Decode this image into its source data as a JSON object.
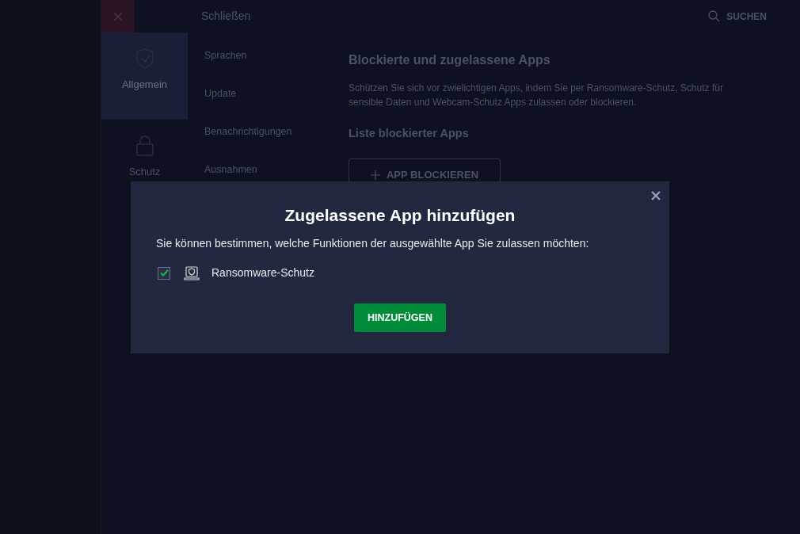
{
  "header": {
    "close_label": "Schließen",
    "search_label": "SUCHEN"
  },
  "categories": [
    {
      "label": "Allgemein",
      "kind": "shield",
      "selected": true
    },
    {
      "label": "Schutz",
      "kind": "lock",
      "selected": false
    }
  ],
  "menu": [
    {
      "label": "Sprachen"
    },
    {
      "label": "Update"
    },
    {
      "label": "Benachrichtigungen"
    },
    {
      "label": "Ausnahmen"
    }
  ],
  "content": {
    "title": "Blockierte und zugelassene Apps",
    "description": "Schützen Sie sich vor zwielichtigen Apps, indem Sie per Ransomware-Schutz, Schutz für sensible Daten und Webcam-Schutz Apps zulassen oder blockieren.",
    "list_title": "Liste blockierter Apps",
    "block_button": "APP BLOCKIEREN"
  },
  "dialog": {
    "title": "Zugelassene App hinzufügen",
    "text": "Sie können bestimmen, welche Funktionen der ausgewählte App Sie zulassen möchten:",
    "options": [
      {
        "label": "Ransomware-Schutz",
        "checked": true
      }
    ],
    "button": "HINZUFÜGEN"
  }
}
